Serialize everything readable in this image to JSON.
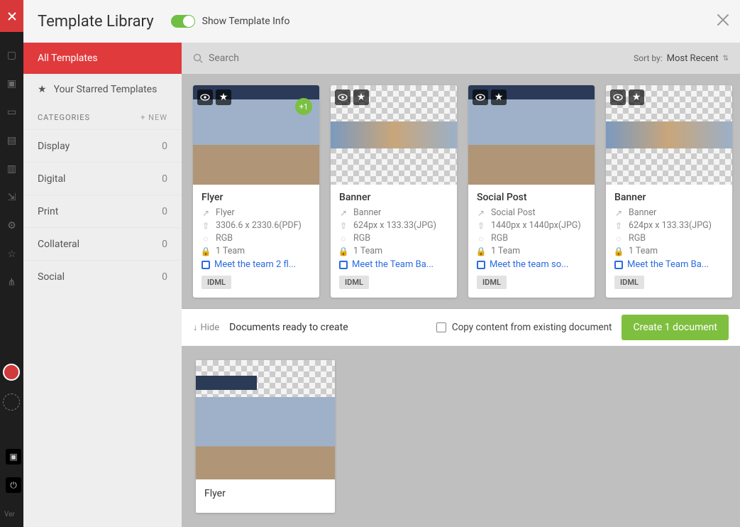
{
  "header": {
    "title": "Template Library",
    "toggle_label": "Show Template Info",
    "toggle_on": true
  },
  "sidebar": {
    "all_label": "All Templates",
    "starred_label": "Your Starred Templates",
    "categories_header": "CATEGORIES",
    "new_label": "+ NEW",
    "categories": [
      {
        "label": "Display",
        "count": "0"
      },
      {
        "label": "Digital",
        "count": "0"
      },
      {
        "label": "Print",
        "count": "0"
      },
      {
        "label": "Collateral",
        "count": "0"
      },
      {
        "label": "Social",
        "count": "0"
      }
    ]
  },
  "searchbar": {
    "placeholder": "Search",
    "sort_label": "Sort by:",
    "sort_value": "Most Recent"
  },
  "templates": [
    {
      "title": "Flyer",
      "type": "Flyer",
      "dims": "3306.6 x 2330.6(PDF)",
      "color": "RGB",
      "team": "1 Team",
      "link": "Meet the team 2 fl...",
      "tag": "IDML",
      "variant": "full",
      "badge": "+1"
    },
    {
      "title": "Banner",
      "type": "Banner",
      "dims": "624px x 133.33(JPG)",
      "color": "RGB",
      "team": "1 Team",
      "link": "Meet the Team Ba...",
      "tag": "IDML",
      "variant": "strip"
    },
    {
      "title": "Social Post",
      "type": "Social Post",
      "dims": "1440px x 1440px(JPG)",
      "color": "RGB",
      "team": "1 Team",
      "link": "Meet the team so...",
      "tag": "IDML",
      "variant": "full"
    },
    {
      "title": "Banner",
      "type": "Banner",
      "dims": "624px x 133.33(JPG)",
      "color": "RGB",
      "team": "1 Team",
      "link": "Meet the Team Ba...",
      "tag": "IDML",
      "variant": "strip"
    }
  ],
  "docsbar": {
    "hide_label": "Hide",
    "ready_label": "Documents ready to create",
    "copy_label": "Copy content from existing document",
    "create_label": "Create 1 document"
  },
  "selected_docs": [
    {
      "title": "Flyer"
    }
  ],
  "appbg": {
    "ver": "Ver"
  }
}
